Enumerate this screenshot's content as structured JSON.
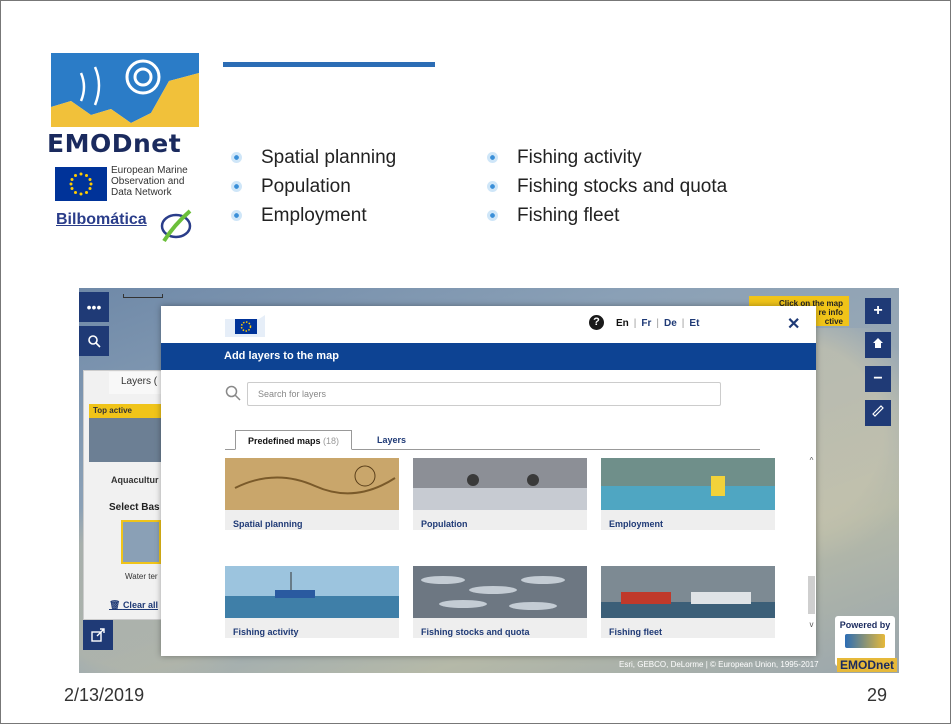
{
  "logo": {
    "brand": "EMODnet",
    "subtitle_lines": [
      "European Marine",
      "Observation and",
      "Data Network"
    ],
    "partner": "Bilbomática"
  },
  "bullets": {
    "left": [
      "Spatial planning",
      "Population",
      "Employment"
    ],
    "right": [
      "Fishing activity",
      "Fishing stocks and quota",
      "Fishing fleet"
    ]
  },
  "app": {
    "left_panel": {
      "layers_tab": "Layers (",
      "top_active": "Top active",
      "aqua_label": "Aquacultur",
      "select_base": "Select Bas",
      "water_label": "Water ter",
      "clear_all": "Clear all"
    },
    "click_info": "Click on the map ... re info ... ctive",
    "right_tools": [
      "+",
      "home",
      "−",
      "ruler"
    ],
    "powered_by": "Powered by",
    "attribution": "Esri, GEBCO, DeLorme | © European Union, 1995-2017",
    "footer_brand": "EMODnet",
    "modal": {
      "languages": [
        "En",
        "Fr",
        "De",
        "Et"
      ],
      "active_language": "En",
      "header": "Add layers to the map",
      "search_placeholder": "Search for layers",
      "tabs": [
        {
          "label": "Predefined maps",
          "count": "(18)",
          "active": true
        },
        {
          "label": "Layers",
          "active": false
        }
      ],
      "cards": [
        {
          "label": "Spatial planning"
        },
        {
          "label": "Population"
        },
        {
          "label": "Employment"
        },
        {
          "label": "Fishing activity"
        },
        {
          "label": "Fishing stocks and quota"
        },
        {
          "label": "Fishing fleet"
        }
      ]
    }
  },
  "footer": {
    "date": "2/13/2019",
    "page": "29"
  },
  "colors": {
    "brand_blue": "#0d4393",
    "accent_yellow": "#f0c419",
    "title_bar": "#2c6db5"
  }
}
